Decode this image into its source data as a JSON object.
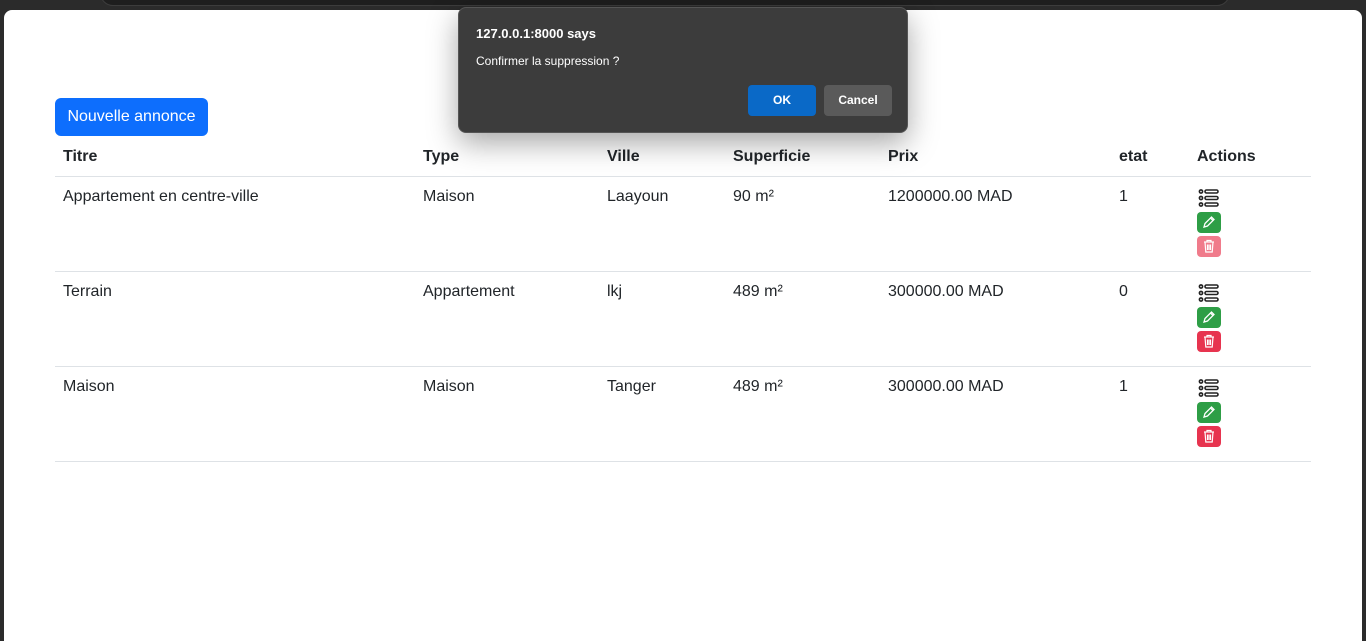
{
  "toolbar": {
    "new_button_label": "Nouvelle annonce"
  },
  "table": {
    "headers": [
      "Titre",
      "Type",
      "Ville",
      "Superficie",
      "Prix",
      "etat",
      "Actions"
    ],
    "rows": [
      {
        "titre": "Appartement en centre-ville",
        "type": "Maison",
        "ville": "Laayoun",
        "superficie": "90 m²",
        "prix": "1200000.00 MAD",
        "etat": "1"
      },
      {
        "titre": "Terrain",
        "type": "Appartement",
        "ville": "lkj",
        "superficie": "489 m²",
        "prix": "300000.00 MAD",
        "etat": "0"
      },
      {
        "titre": "Maison",
        "type": "Maison",
        "ville": "Tanger",
        "superficie": "489 m²",
        "prix": "300000.00 MAD",
        "etat": "1"
      }
    ]
  },
  "dialog": {
    "title": "127.0.0.1:8000 says",
    "message": "Confirmer la suppression ?",
    "ok_label": "OK",
    "cancel_label": "Cancel"
  },
  "colors": {
    "primary": "#0d6efd",
    "success": "#2e9e46",
    "danger": "#e7344f",
    "dialog_bg": "#3c3c3c"
  }
}
